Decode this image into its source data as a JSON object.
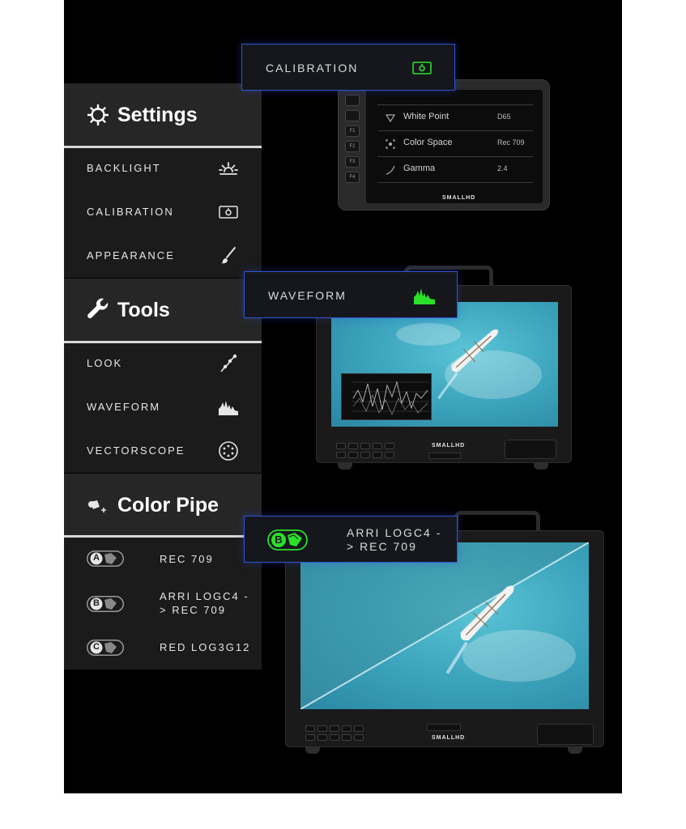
{
  "sidebar": {
    "settings": {
      "title": "Settings",
      "icon": "gear-icon",
      "items": [
        {
          "label": "BACKLIGHT",
          "icon": "sunrise-icon"
        },
        {
          "label": "CALIBRATION",
          "icon": "calibration-icon"
        },
        {
          "label": "APPEARANCE",
          "icon": "brush-icon"
        }
      ]
    },
    "tools": {
      "title": "Tools",
      "icon": "wrench-icon",
      "items": [
        {
          "label": "LOOK",
          "icon": "curve-icon"
        },
        {
          "label": "WAVEFORM",
          "icon": "waveform-icon"
        },
        {
          "label": "VECTORSCOPE",
          "icon": "vectorscope-icon"
        }
      ]
    },
    "color_pipe": {
      "title": "Color Pipe",
      "icon": "color-pipe-icon",
      "items": [
        {
          "badge": "A",
          "label": "REC 709"
        },
        {
          "badge": "B",
          "label": "ARRI LOGC4 - > REC 709"
        },
        {
          "badge": "C",
          "label": "RED LOG3G12"
        }
      ]
    }
  },
  "callouts": {
    "calibration": {
      "label": "CALIBRATION",
      "icon": "calibration-icon"
    },
    "waveform": {
      "label": "WAVEFORM",
      "icon": "waveform-icon"
    },
    "color_pipe": {
      "badge": "B",
      "label": "ARRI LOGC4 - > REC 709"
    }
  },
  "handheld": {
    "buttons": [
      "",
      "",
      "F1",
      "F2",
      "F3",
      "F4"
    ],
    "rows": [
      {
        "key": "White Point",
        "value": "D65",
        "icon": "white-point-icon"
      },
      {
        "key": "Color Space",
        "value": "Rec 709",
        "icon": "color-space-icon"
      },
      {
        "key": "Gamma",
        "value": "2.4",
        "icon": "gamma-icon"
      }
    ],
    "brand": "SMALLHD"
  },
  "monitors": {
    "brand": "SMALLHD"
  },
  "colors": {
    "accent_green": "#2be02b",
    "callout_border": "#2f55d4",
    "panel": "#1b1b1b",
    "panel_header": "#262626"
  }
}
